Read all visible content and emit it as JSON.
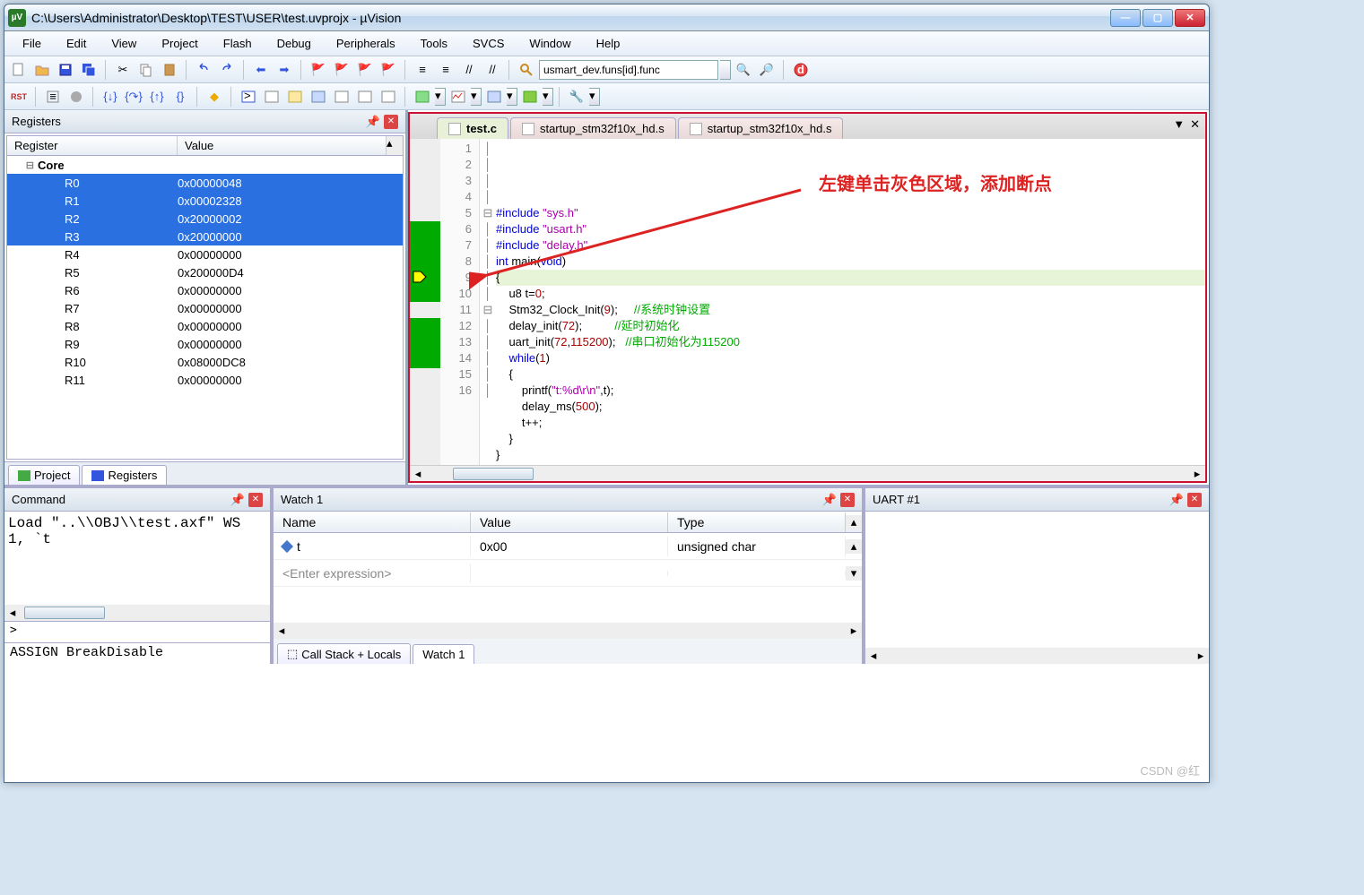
{
  "window": {
    "title": "C:\\Users\\Administrator\\Desktop\\TEST\\USER\\test.uvprojx - µVision"
  },
  "menu": [
    "File",
    "Edit",
    "View",
    "Project",
    "Flash",
    "Debug",
    "Peripherals",
    "Tools",
    "SVCS",
    "Window",
    "Help"
  ],
  "search_box": "usmart_dev.funs[id].func",
  "registers": {
    "title": "Registers",
    "columns": [
      "Register",
      "Value"
    ],
    "group": "Core",
    "rows": [
      {
        "name": "R0",
        "value": "0x00000048",
        "sel": true
      },
      {
        "name": "R1",
        "value": "0x00002328",
        "sel": true
      },
      {
        "name": "R2",
        "value": "0x20000002",
        "sel": true
      },
      {
        "name": "R3",
        "value": "0x20000000",
        "sel": true
      },
      {
        "name": "R4",
        "value": "0x00000000",
        "sel": false
      },
      {
        "name": "R5",
        "value": "0x200000D4",
        "sel": false
      },
      {
        "name": "R6",
        "value": "0x00000000",
        "sel": false
      },
      {
        "name": "R7",
        "value": "0x00000000",
        "sel": false
      },
      {
        "name": "R8",
        "value": "0x00000000",
        "sel": false
      },
      {
        "name": "R9",
        "value": "0x00000000",
        "sel": false
      },
      {
        "name": "R10",
        "value": "0x08000DC8",
        "sel": false
      },
      {
        "name": "R11",
        "value": "0x00000000",
        "sel": false
      }
    ],
    "tabs": [
      "Project",
      "Registers"
    ]
  },
  "editor": {
    "tabs": [
      "test.c",
      "startup_stm32f10x_hd.s",
      "startup_stm32f10x_hd.s"
    ],
    "active_tab": 0,
    "callout": "左键单击灰色区域，添加断点",
    "lines": [
      {
        "n": 1,
        "html": "<span class='kw'>#include</span> <span class='str'>\"sys.h\"</span>"
      },
      {
        "n": 2,
        "html": "<span class='kw'>#include</span> <span class='str'>\"usart.h\"</span>"
      },
      {
        "n": 3,
        "html": "<span class='kw'>#include</span> <span class='str'>\"delay.h\"</span>"
      },
      {
        "n": 4,
        "html": "<span class='kw'>int</span> main(<span class='kw'>void</span>)"
      },
      {
        "n": 5,
        "html": "{",
        "fold": "-",
        "hl": true
      },
      {
        "n": 6,
        "html": "    u8 t=<span class='num'>0</span>;"
      },
      {
        "n": 7,
        "html": "    Stm32_Clock_Init(<span class='num'>9</span>);     <span class='cmt'>//系统时钟设置</span>"
      },
      {
        "n": 8,
        "html": "    delay_init(<span class='num'>72</span>);          <span class='cmt'>//延时初始化</span>"
      },
      {
        "n": 9,
        "html": "    uart_init(<span class='num'>72</span>,<span class='num'>115200</span>);   <span class='cmt'>//串口初始化为115200</span>"
      },
      {
        "n": 10,
        "html": "    <span class='kw'>while</span>(<span class='num'>1</span>)"
      },
      {
        "n": 11,
        "html": "    {",
        "fold": "-"
      },
      {
        "n": 12,
        "html": "        printf(<span class='str'>\"t:%d\\r\\n\"</span>,t);"
      },
      {
        "n": 13,
        "html": "        delay_ms(<span class='num'>500</span>);"
      },
      {
        "n": 14,
        "html": "        t++;"
      },
      {
        "n": 15,
        "html": "    }"
      },
      {
        "n": 16,
        "html": "}"
      }
    ]
  },
  "command": {
    "title": "Command",
    "body": "Load \"..\\\\OBJ\\\\test.axf\"\nWS 1, `t",
    "prompt": ">",
    "assign": "ASSIGN BreakDisable"
  },
  "watch": {
    "title": "Watch 1",
    "columns": [
      "Name",
      "Value",
      "Type"
    ],
    "rows": [
      {
        "name": "t",
        "value": "0x00",
        "type": "unsigned char"
      }
    ],
    "enter": "<Enter expression>",
    "tabs": [
      "Call Stack + Locals",
      "Watch 1"
    ]
  },
  "uart": {
    "title": "UART #1"
  },
  "watermark": "CSDN @红"
}
